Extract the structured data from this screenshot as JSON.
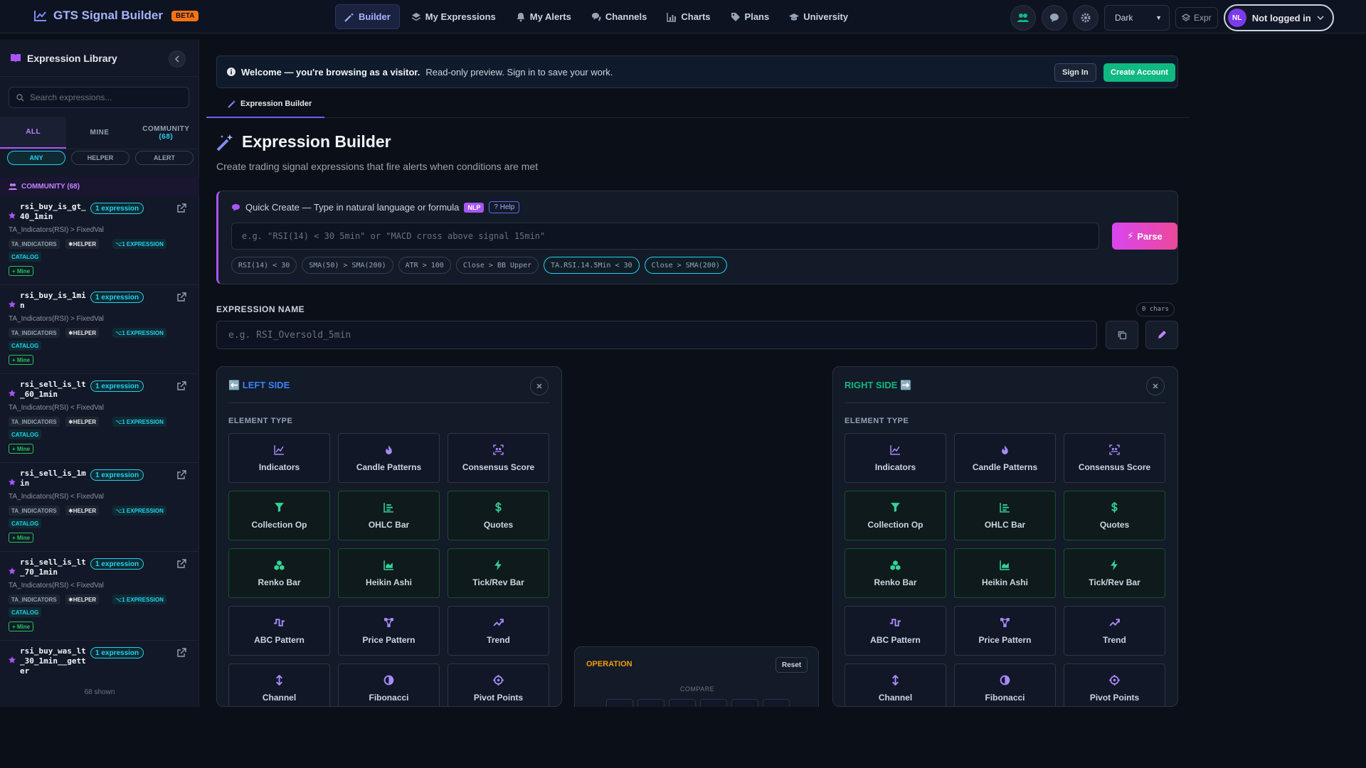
{
  "nav": {
    "brand": "GTS Signal Builder",
    "beta": "BETA",
    "tabs": [
      {
        "label": "Builder",
        "icon": "wand-icon"
      },
      {
        "label": "My Expressions",
        "icon": "layers-icon"
      },
      {
        "label": "My Alerts",
        "icon": "bell-icon"
      },
      {
        "label": "Channels",
        "icon": "chat-icon"
      },
      {
        "label": "Charts",
        "icon": "chart-icon"
      },
      {
        "label": "Plans",
        "icon": "tag-icon"
      },
      {
        "label": "University",
        "icon": "graduation-icon"
      }
    ],
    "theme": "Dark",
    "expr": "Expr",
    "user_initials": "NL",
    "user_label": "Not logged in"
  },
  "sidebar": {
    "title": "Expression Library",
    "search_placeholder": "Search expressions...",
    "tabs": {
      "all": "ALL",
      "mine": "MINE",
      "community": "COMMUNITY",
      "community_count": "(68)"
    },
    "filters": [
      "ANY",
      "HELPER",
      "ALERT"
    ],
    "community_label": "COMMUNITY (68)",
    "items": [
      {
        "name": "rsi_buy_is_gt_40_1min",
        "badge": "1 expression",
        "sub": "TA_Indicators(RSI) > FixedVal"
      },
      {
        "name": "rsi_buy_is_1min",
        "badge": "1 expression",
        "sub": "TA_Indicators(RSI) > FixedVal"
      },
      {
        "name": "rsi_sell_is_lt_60_1min",
        "badge": "1 expression",
        "sub": "TA_Indicators(RSI) < FixedVal"
      },
      {
        "name": "rsi_sell_is_1min",
        "badge": "1 expression",
        "sub": "TA_Indicators(RSI) < FixedVal"
      },
      {
        "name": "rsi_sell_is_lt_70_1min",
        "badge": "1 expression",
        "sub": "TA_Indicators(RSI) < FixedVal"
      },
      {
        "name": "rsi_buy_was_lt_30_1min__getter",
        "badge": "1 expression",
        "sub": ""
      }
    ],
    "tags": {
      "ta": "TA_INDICATORS",
      "helper": "HELPER",
      "expr": "1 EXPRESSION",
      "catalog": "CATALOG",
      "mine": "+ Mine"
    },
    "shown": "68 shown"
  },
  "main": {
    "banner_bold": "Welcome — you're browsing as a visitor.",
    "banner_text": "Read-only preview. Sign in to save your work.",
    "signin": "Sign In",
    "create": "Create Account",
    "subtab": "Expression Builder",
    "title": "Expression Builder",
    "subtitle": "Create trading signal expressions that fire alerts when conditions are met",
    "qc_title": "Quick Create — Type in natural language or formula",
    "nlp": "NLP",
    "help": "Help",
    "qc_placeholder": "e.g. \"RSI(14) < 30 5min\" or \"MACD cross above signal 15min\"",
    "parse": "Parse",
    "chips": [
      "RSI(14) < 30",
      "SMA(50) > SMA(200)",
      "ATR > 100",
      "Close > BB Upper",
      "TA.RSI.14.5Min < 30",
      "Close > SMA(200)"
    ],
    "name_label": "EXPRESSION NAME",
    "chars": "0 chars",
    "name_placeholder": "e.g. RSI_Oversold_5min",
    "left_title": "⬅️ LEFT SIDE",
    "right_title": "RIGHT SIDE ➡️",
    "element_type": "ELEMENT TYPE",
    "cards": [
      {
        "label": "Indicators",
        "icon": "line-chart-icon",
        "green": false
      },
      {
        "label": "Candle Patterns",
        "icon": "flame-icon",
        "green": false
      },
      {
        "label": "Consensus Score",
        "icon": "scan-icon",
        "green": false
      },
      {
        "label": "Collection Op",
        "icon": "filter-icon",
        "green": true
      },
      {
        "label": "OHLC Bar",
        "icon": "bar-chart-icon",
        "green": true
      },
      {
        "label": "Quotes",
        "icon": "dollar-icon",
        "green": true
      },
      {
        "label": "Renko Bar",
        "icon": "cubes-icon",
        "green": true
      },
      {
        "label": "Heikin Ashi",
        "icon": "area-chart-icon",
        "green": true
      },
      {
        "label": "Tick/Rev Bar",
        "icon": "bolt-icon",
        "green": true
      },
      {
        "label": "ABC Pattern",
        "icon": "wave-icon",
        "green": false
      },
      {
        "label": "Price Pattern",
        "icon": "nodes-icon",
        "green": false
      },
      {
        "label": "Trend",
        "icon": "trend-icon",
        "green": false
      },
      {
        "label": "Channel",
        "icon": "updown-icon",
        "green": false
      },
      {
        "label": "Fibonacci",
        "icon": "half-circle-icon",
        "green": false
      },
      {
        "label": "Pivot Points",
        "icon": "crosshair-icon",
        "green": false
      }
    ],
    "op_title": "OPERATION",
    "op_reset": "Reset",
    "op_compare": "COMPARE"
  }
}
